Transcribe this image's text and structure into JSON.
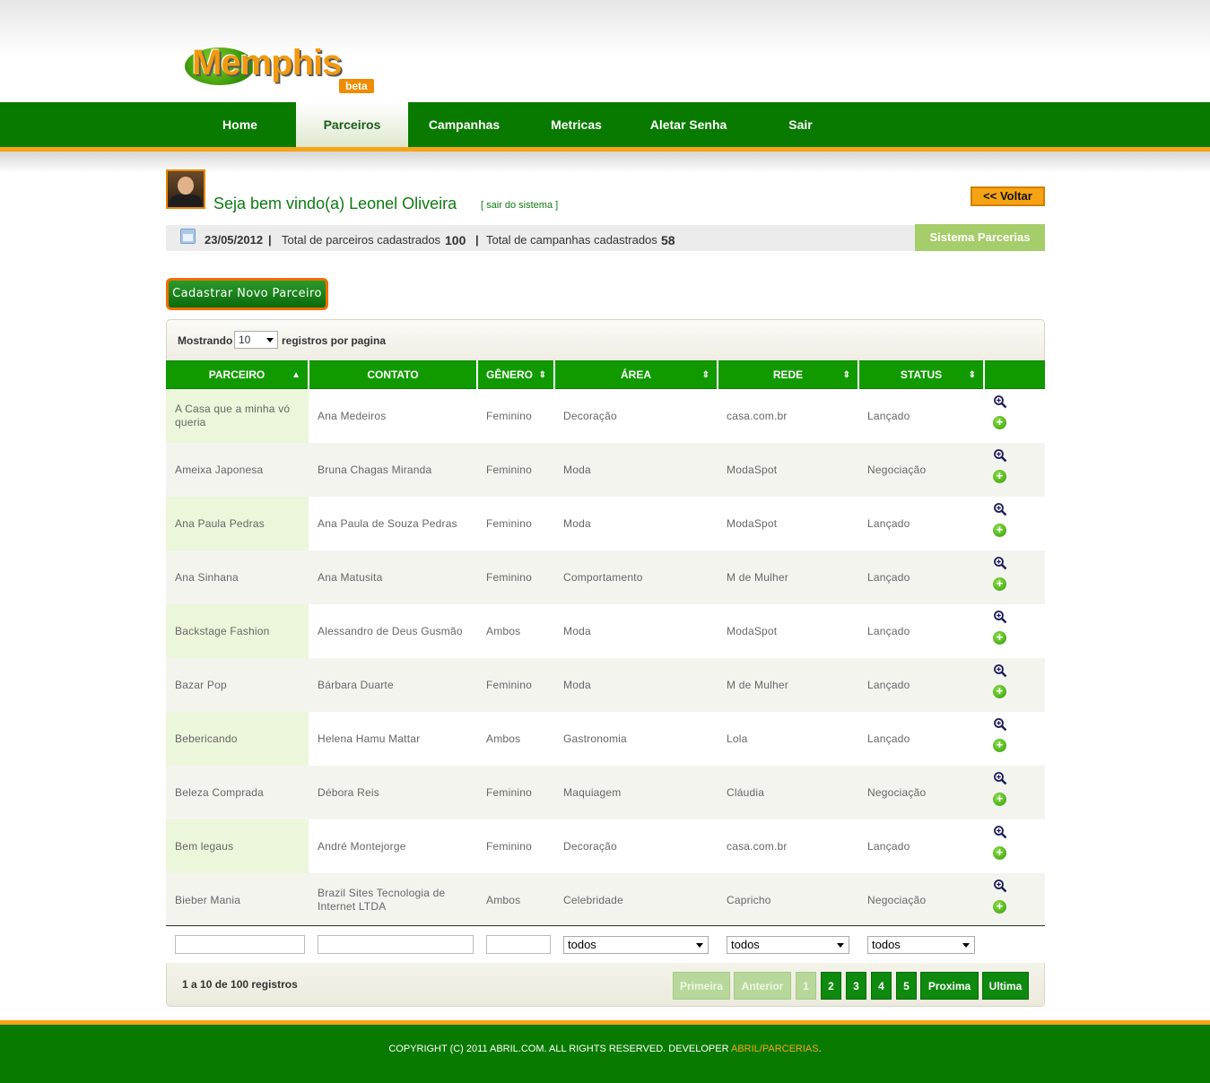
{
  "logo": {
    "name": "Memphis",
    "tag": "beta"
  },
  "nav": [
    {
      "label": "Home",
      "active": false
    },
    {
      "label": "Parceiros",
      "active": true
    },
    {
      "label": "Campanhas",
      "active": false
    },
    {
      "label": "Metricas",
      "active": false
    },
    {
      "label": "Aletar Senha",
      "active": false
    },
    {
      "label": "Sair",
      "active": false
    }
  ],
  "user": {
    "welcome": "Seja bem vindo(a) Leonel Oliveira",
    "logout": "[ sair do sistema ]"
  },
  "back_label": "<< Voltar",
  "infobar": {
    "date": "23/05/2012",
    "sep": "|",
    "parceiros_label": "Total de parceiros cadastrados",
    "parceiros_count": "100",
    "campanhas_label": "Total de campanhas cadastrados",
    "campanhas_count": "58"
  },
  "system_badge": "Sistema Parcerias",
  "new_partner_button": "Cadastrar Novo Parceiro",
  "list_controls": {
    "showing": "Mostrando",
    "page_size": "10",
    "per_page": "registros por pagina"
  },
  "table": {
    "columns": [
      "PARCEIRO",
      "CONTATO",
      "GÊNERO",
      "ÁREA",
      "REDE",
      "STATUS",
      ""
    ],
    "rows": [
      [
        "A Casa que a minha vó queria",
        "Ana Medeiros",
        "Feminino",
        "Decoração",
        "casa.com.br",
        "Lançado"
      ],
      [
        "Ameixa Japonesa",
        "Bruna Chagas Miranda",
        "Feminino",
        "Moda",
        "ModaSpot",
        "Negociação"
      ],
      [
        "Ana Paula Pedras",
        "Ana Paula de Souza Pedras",
        "Feminino",
        "Moda",
        "ModaSpot",
        "Lançado"
      ],
      [
        "Ana Sinhana",
        "Ana Matusita",
        "Feminino",
        "Comportamento",
        "M de Mulher",
        "Lançado"
      ],
      [
        "Backstage Fashion",
        "Alessandro de Deus Gusmão",
        "Ambos",
        "Moda",
        "ModaSpot",
        "Lançado"
      ],
      [
        "Bazar Pop",
        "Bárbara Duarte",
        "Feminino",
        "Moda",
        "M de Mulher",
        "Lançado"
      ],
      [
        "Bebericando",
        "Helena Hamu Mattar",
        "Ambos",
        "Gastronomia",
        "Lola",
        "Lançado"
      ],
      [
        "Beleza Comprada",
        "Débora Reis",
        "Feminino",
        "Maquiagem",
        "Cláudia",
        "Negociação"
      ],
      [
        "Bem legaus",
        "André Montejorge",
        "Feminino",
        "Decoração",
        "casa.com.br",
        "Lançado"
      ],
      [
        "Bieber Mania",
        "Brazil Sites Tecnologia de Internet LTDA",
        "Ambos",
        "Celebridade",
        "Capricho",
        "Negociação"
      ]
    ]
  },
  "filters": {
    "area": "todos",
    "rede": "todos",
    "status": "todos"
  },
  "pagination": {
    "summary": "1 a 10 de 100 registros",
    "first": "Primeira",
    "prev": "Anterior",
    "pages": [
      "1",
      "2",
      "3",
      "4",
      "5"
    ],
    "next": "Proxima",
    "last": "Ultima"
  },
  "footer": {
    "text": "COPYRIGHT (C) 2011 ABRIL.COM. ALL RIGHTS RESERVED. DEVELOPER ",
    "link": "ABRIL/PARCERIAS",
    "end": "."
  },
  "colors": {
    "brand_green": "#087a00",
    "accent_orange": "#f5a314",
    "header_green": "#119a00"
  }
}
